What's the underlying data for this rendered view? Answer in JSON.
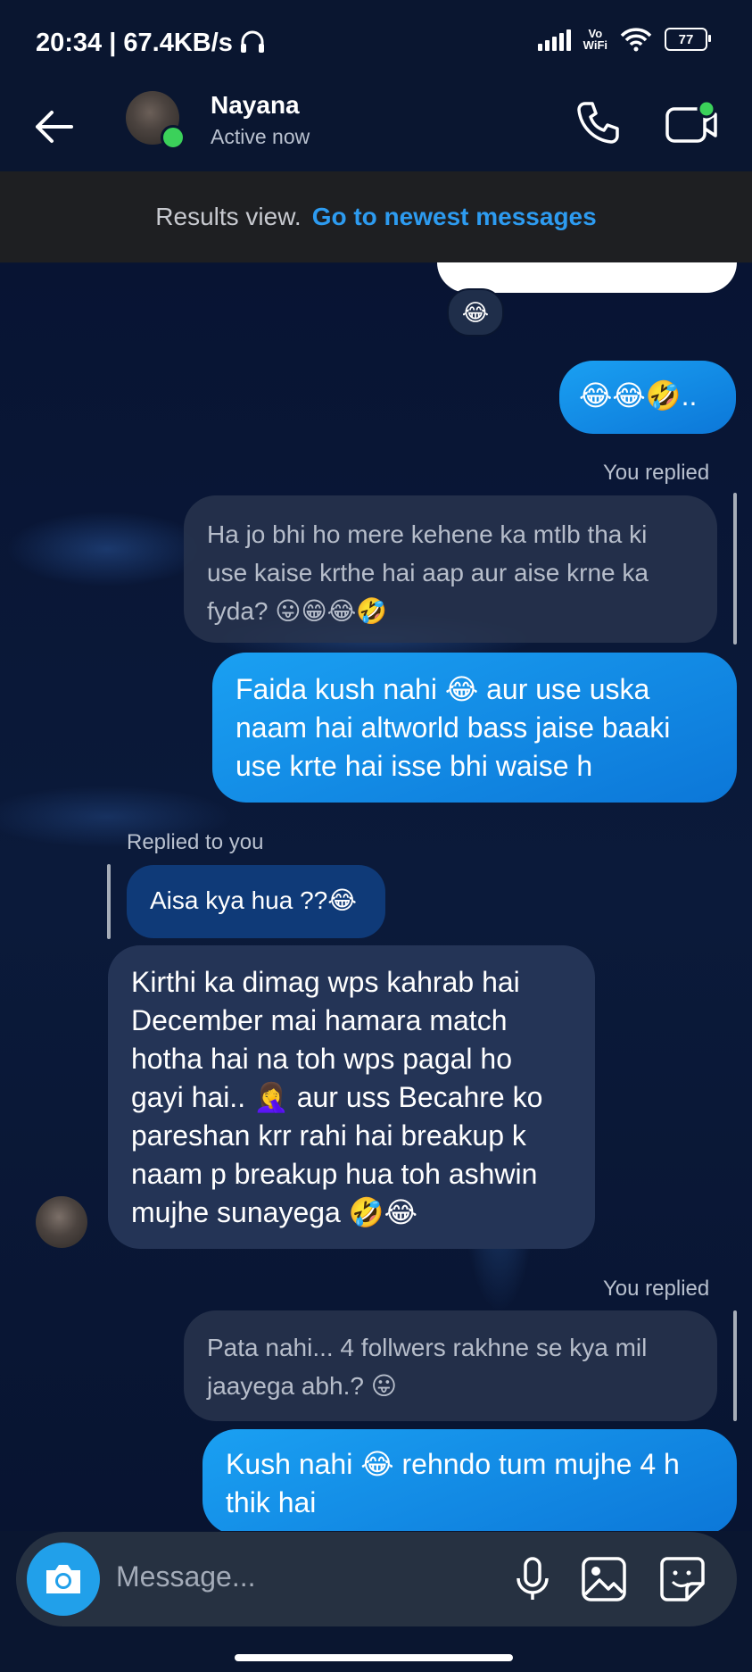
{
  "status_bar": {
    "time_speed": "20:34 | 67.4KB/s",
    "vowifi_top": "Vo",
    "vowifi_bottom": "WiFi",
    "battery": "77"
  },
  "header": {
    "name": "Nayana",
    "status": "Active now"
  },
  "banner": {
    "text": "Results view.",
    "link": "Go to newest messages"
  },
  "messages": {
    "reaction": "😂",
    "m1": "😂😂🤣..",
    "reply_label_1": "You replied",
    "quote_1": "Ha jo bhi ho mere kehene ka mtlb tha ki use kaise krthe hai aap aur aise krne ka fyda? 😛😁😂🤣",
    "m2": "Faida kush nahi 😂 aur use uska naam hai altworld bass jaise baaki use krte hai isse bhi waise h",
    "reply_label_2": "Replied to you",
    "quote_2": "Aisa kya hua ??😂",
    "m3": "Kirthi ka dimag wps kahrab hai December mai hamara match hotha hai na toh wps pagal ho gayi hai.. 🤦‍♀️ aur uss Becahre ko pareshan krr rahi hai breakup k naam p breakup hua toh ashwin mujhe sunayega 🤣😂",
    "reply_label_3": "You replied",
    "quote_3": "Pata nahi... 4 follwers rakhne se kya mil jaayega abh.? 😛",
    "m4": "Kush nahi 😂 rehndo tum mujhe 4 h thik hai"
  },
  "composer": {
    "placeholder": "Message..."
  },
  "colors": {
    "accent": "#1aa0f2",
    "link": "#2d9bf0",
    "online": "#3bd15a",
    "background": "#0a1630"
  },
  "icons": [
    "back-arrow-icon",
    "phone-icon",
    "video-call-icon",
    "camera-icon",
    "microphone-icon",
    "gallery-icon",
    "sticker-icon",
    "signal-icon",
    "wifi-icon",
    "headphones-icon"
  ]
}
